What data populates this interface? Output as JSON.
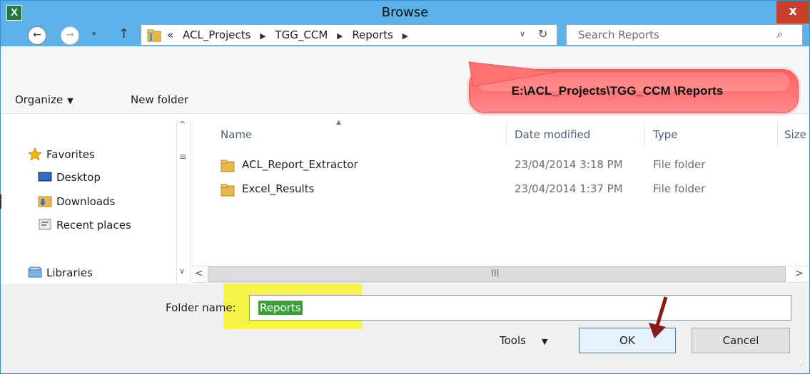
{
  "window": {
    "title": "Browse",
    "app_icon_letter": "X",
    "close_glyph": "x"
  },
  "nav": {
    "back_glyph": "←",
    "forward_glyph": "→",
    "recent_glyph": "▾",
    "up_glyph": "↑",
    "address": {
      "overflow": "«",
      "crumbs": [
        "ACL_Projects",
        "TGG_CCM",
        "Reports"
      ],
      "crumb_sep": "▶",
      "dropdown_glyph": "∨",
      "refresh_glyph": "↻"
    },
    "search": {
      "placeholder": "Search Reports",
      "icon_glyph": "⌕"
    }
  },
  "toolbar": {
    "organize_label": "Organize",
    "organize_caret": "▼",
    "new_folder_label": "New folder"
  },
  "sidebar": {
    "favorites": "Favorites",
    "items": [
      {
        "label": "Desktop",
        "icon": "desktop-icon"
      },
      {
        "label": "Downloads",
        "icon": "downloads-icon"
      },
      {
        "label": "Recent places",
        "icon": "recent-places-icon"
      }
    ],
    "libraries": "Libraries",
    "scroll_up": "^",
    "scroll_grip": "≡",
    "scroll_down": "∨"
  },
  "filelist": {
    "columns": [
      "Name",
      "Date modified",
      "Type",
      "Size"
    ],
    "sort_glyph": "▲",
    "rows": [
      {
        "name": "ACL_Report_Extractor",
        "date": "23/04/2014 3:18 PM",
        "type": "File folder"
      },
      {
        "name": "Excel_Results",
        "date": "23/04/2014 1:37 PM",
        "type": "File folder"
      }
    ],
    "hscroll": {
      "left": "<",
      "grip": "III",
      "right": ">"
    }
  },
  "footer": {
    "folder_name_label": "Folder name:",
    "folder_name_value": "Reports",
    "tools_label": "Tools",
    "tools_caret": "▼",
    "ok_label": "OK",
    "cancel_label": "Cancel",
    "resize_glyph": ".:"
  },
  "annotation": {
    "callout_text": "E:\\ACL_Projects\\TGG_CCM \\Reports",
    "color": "#ff6b6b",
    "arrow_color": "#8b1a1a"
  },
  "colors": {
    "titlebar": "#5bb1e8",
    "close": "#c7402e",
    "highlight": "#f6f446",
    "selection": "#3aa03a"
  }
}
